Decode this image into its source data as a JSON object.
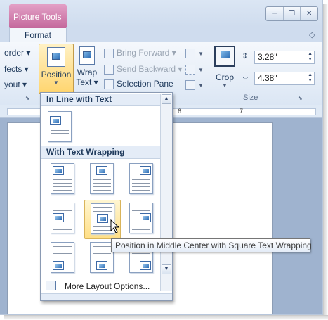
{
  "window": {
    "context_tab_label": "Picture Tools",
    "tab_format_label": "Format",
    "controls": [
      "─",
      "❐",
      "✕"
    ],
    "help_icon": "help-icon"
  },
  "ribbon": {
    "left_items": [
      "order ▾",
      "fects ▾",
      "yout ▾"
    ],
    "position_label": "Position",
    "wrap_label_1": "Wrap",
    "wrap_label_2": "Text ▾",
    "bring_forward": "Bring Forward ▾",
    "send_backward": "Send Backward ▾",
    "selection_pane": "Selection Pane",
    "crop_label": "Crop",
    "height_value": "3.28\"",
    "width_value": "4.38\"",
    "size_group_label": "Size"
  },
  "ruler": {
    "marks": [
      "6",
      "7"
    ]
  },
  "dropdown": {
    "section_inline": "In Line with Text",
    "section_wrapping": "With Text Wrapping",
    "more_layout_options": "More Layout Options...",
    "selected_item": "Position in Middle Center with Square Text Wrapping"
  },
  "tooltip": {
    "text": "Position in Middle Center with Square Text Wrapping"
  },
  "colors": {
    "accent_context": "#c4689c",
    "selected_highlight": "#ffd56f",
    "ribbon_bg": "#dbe6f4"
  }
}
